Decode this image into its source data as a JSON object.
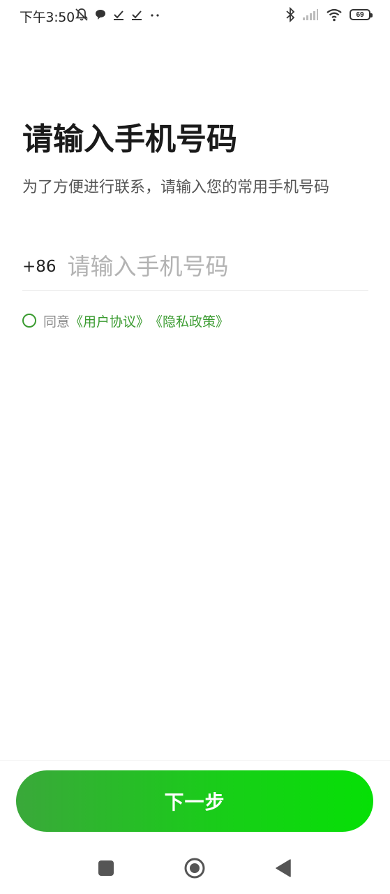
{
  "status_bar": {
    "time": "下午3:50",
    "battery_level": "69",
    "icons": [
      "mute-bell-icon",
      "chat-bubble-icon",
      "check-icon",
      "check-icon",
      "more-dots-icon",
      "bluetooth-icon",
      "signal-icon",
      "wifi-icon",
      "battery-icon"
    ]
  },
  "main": {
    "title": "请输入手机号码",
    "subtitle": "为了方便进行联系，请输入您的常用手机号码",
    "phone": {
      "country_code": "+86",
      "placeholder": "请输入手机号码",
      "value": ""
    },
    "agreement": {
      "prefix": "同意",
      "user_agreement": "《用户协议》",
      "privacy_policy": "《隐私政策》",
      "checked": false
    }
  },
  "footer": {
    "next_label": "下一步"
  },
  "nav_bar": {
    "icons": [
      "recent-apps-icon",
      "home-icon",
      "back-icon"
    ]
  },
  "colors": {
    "accent": "#3a9b30",
    "button_start": "#3aa83a",
    "button_end": "#06e006"
  }
}
